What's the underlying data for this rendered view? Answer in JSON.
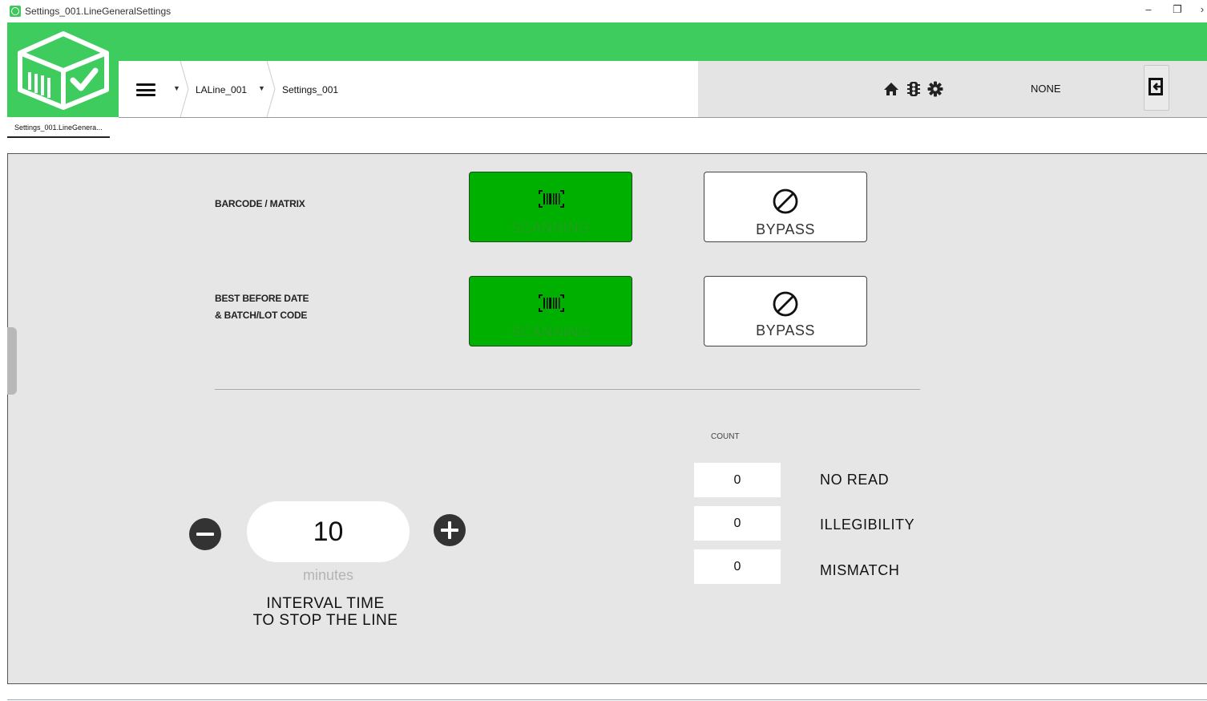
{
  "window": {
    "title": "Settings_001.LineGeneralSettings",
    "minimize_glyph": "–",
    "restore_glyph": "❐",
    "close_glyph": "›"
  },
  "header": {
    "breadcrumbs": [
      "LALine_001",
      "Settings_001"
    ],
    "status_value": "NONE",
    "icons": [
      "home-icon",
      "traffic-light-icon",
      "gear-icon",
      "logout-icon"
    ]
  },
  "tabs": {
    "active_label": "Settings_001.LineGenera..."
  },
  "scan_rows": [
    {
      "label_lines": [
        "BARCODE / MATRIX"
      ],
      "scan_label": "SCANNING",
      "bypass_label": "BYPASS",
      "state": "scanning"
    },
    {
      "label_lines": [
        "BEST BEFORE DATE",
        "& BATCH/LOT CODE"
      ],
      "scan_label": "SCANNING",
      "bypass_label": "BYPASS",
      "state": "scanning"
    }
  ],
  "counts": {
    "heading": "COUNT",
    "items": [
      {
        "label": "NO READ",
        "value": "0"
      },
      {
        "label": "ILLEGIBILITY",
        "value": "0"
      },
      {
        "label": "MISMATCH",
        "value": "0"
      }
    ]
  },
  "interval": {
    "value": "10",
    "unit": "minutes",
    "title_lines": [
      "INTERVAL TIME",
      "TO STOP THE LINE"
    ]
  },
  "colors": {
    "brand_green": "#3dcc5d",
    "scan_green": "#00b000",
    "panel_gray": "#e6e6e6"
  }
}
